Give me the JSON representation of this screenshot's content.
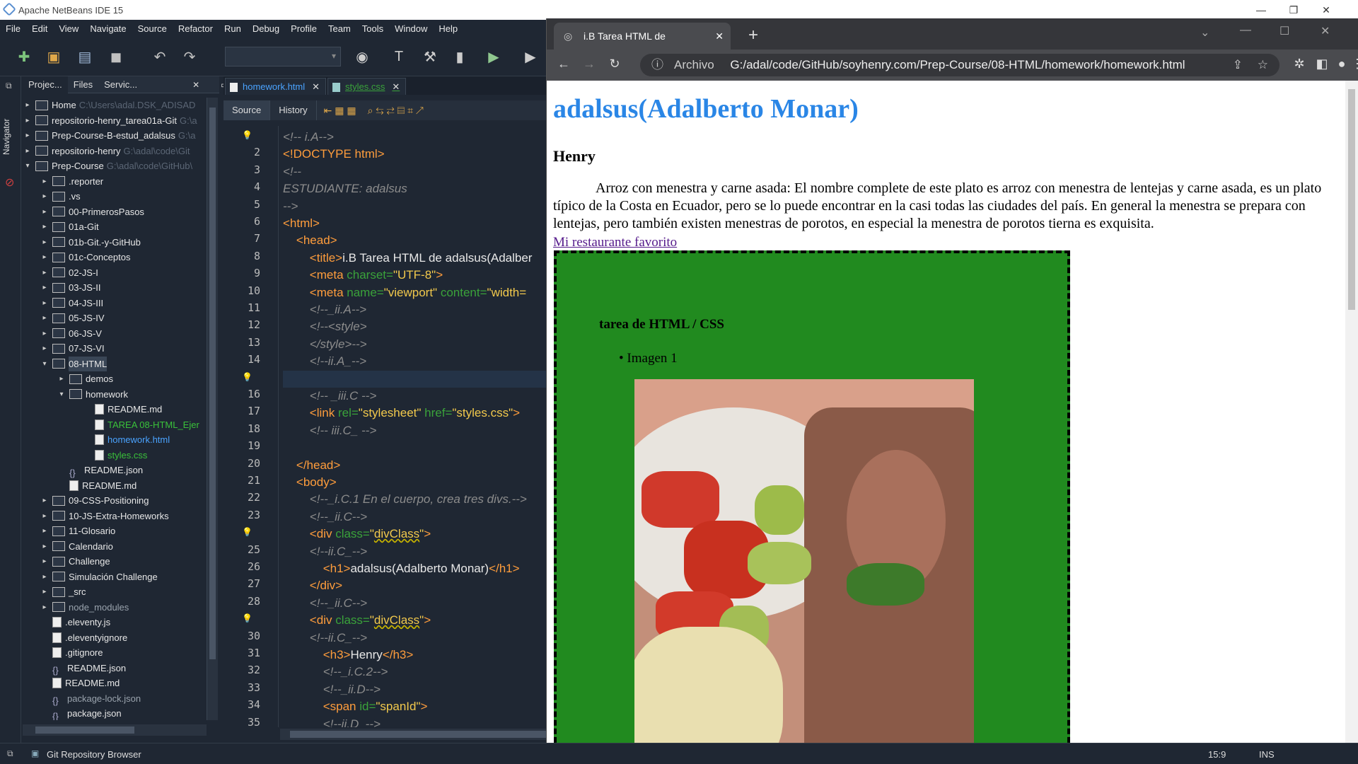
{
  "window": {
    "title": "Apache NetBeans IDE 15"
  },
  "menu": [
    "File",
    "Edit",
    "View",
    "Navigate",
    "Source",
    "Refactor",
    "Run",
    "Debug",
    "Profile",
    "Team",
    "Tools",
    "Window",
    "Help"
  ],
  "navigator_label": "Navigator",
  "project_tabs": [
    "Projec...",
    "Files",
    "Servic..."
  ],
  "tree": [
    {
      "label": "Home",
      "path": "C:\\Users\\adal.DSK_ADISAD",
      "level": 0
    },
    {
      "label": "repositorio-henry_tarea01a-Git",
      "path": "G:\\a",
      "level": 0
    },
    {
      "label": "Prep-Course-B-estud_adalsus",
      "path": "G:\\a",
      "level": 0
    },
    {
      "label": "repositorio-henry",
      "path": "G:\\adal\\code\\Git",
      "level": 0
    },
    {
      "label": "Prep-Course",
      "path": "G:\\adal\\code\\GitHub\\",
      "level": 0
    },
    {
      "label": ".reporter",
      "path": "",
      "level": 1
    },
    {
      "label": ".vs",
      "path": "",
      "level": 1
    },
    {
      "label": "00-PrimerosPasos",
      "path": "",
      "level": 1
    },
    {
      "label": "01a-Git",
      "path": "",
      "level": 1
    },
    {
      "label": "01b-Git.-y-GitHub",
      "path": "",
      "level": 1
    },
    {
      "label": "01c-Conceptos",
      "path": "",
      "level": 1
    },
    {
      "label": "02-JS-I",
      "path": "",
      "level": 1
    },
    {
      "label": "03-JS-II",
      "path": "",
      "level": 1
    },
    {
      "label": "04-JS-III",
      "path": "",
      "level": 1
    },
    {
      "label": "05-JS-IV",
      "path": "",
      "level": 1
    },
    {
      "label": "06-JS-V",
      "path": "",
      "level": 1
    },
    {
      "label": "07-JS-VI",
      "path": "",
      "level": 1
    },
    {
      "label": "08-HTML",
      "path": "",
      "level": 1
    },
    {
      "label": "demos",
      "path": "",
      "level": 2
    },
    {
      "label": "homework",
      "path": "",
      "level": 2
    },
    {
      "label": "README.md",
      "path": "",
      "level": 3
    },
    {
      "label": "TAREA 08-HTML_Ejer",
      "path": "",
      "level": 3
    },
    {
      "label": "homework.html",
      "path": "",
      "level": 3
    },
    {
      "label": "styles.css",
      "path": "",
      "level": 3
    },
    {
      "label": "README.json",
      "path": "",
      "level": 2
    },
    {
      "label": "README.md",
      "path": "",
      "level": 2
    },
    {
      "label": "09-CSS-Positioning",
      "path": "",
      "level": 1
    },
    {
      "label": "10-JS-Extra-Homeworks",
      "path": "",
      "level": 1
    },
    {
      "label": "11-Glosario",
      "path": "",
      "level": 1
    },
    {
      "label": "Calendario",
      "path": "",
      "level": 1
    },
    {
      "label": "Challenge",
      "path": "",
      "level": 1
    },
    {
      "label": "Simulación Challenge",
      "path": "",
      "level": 1
    },
    {
      "label": "_src",
      "path": "",
      "level": 1
    },
    {
      "label": "node_modules",
      "path": "",
      "level": 1
    },
    {
      "label": ".eleventy.js",
      "path": "",
      "level": 1
    },
    {
      "label": ".eleventyignore",
      "path": "",
      "level": 1
    },
    {
      "label": ".gitignore",
      "path": "",
      "level": 1
    },
    {
      "label": "README.json",
      "path": "",
      "level": 1
    },
    {
      "label": "README.md",
      "path": "",
      "level": 1
    },
    {
      "label": "package-lock.json",
      "path": "",
      "level": 1
    },
    {
      "label": "package.json",
      "path": "",
      "level": 1
    }
  ],
  "editor_tabs": [
    "homework.html",
    "styles.css"
  ],
  "editor_modes": [
    "Source",
    "History"
  ],
  "code_lines": [
    {
      "n": "",
      "html": "<span class='cm'>&lt;!-- i.A--&gt;</span>"
    },
    {
      "n": "2",
      "html": "<span class='tg'>&lt;!DOCTYPE html&gt;</span>"
    },
    {
      "n": "3",
      "html": "<span class='cm'>&lt;!--</span>"
    },
    {
      "n": "4",
      "html": "<span class='cm'>ESTUDIANTE:  adalsus</span>"
    },
    {
      "n": "5",
      "html": "<span class='cm'>--&gt;</span>"
    },
    {
      "n": "6",
      "html": "<span class='tg'>&lt;html&gt;</span>"
    },
    {
      "n": "7",
      "html": "&nbsp;&nbsp;&nbsp;&nbsp;<span class='tg'>&lt;head&gt;</span>"
    },
    {
      "n": "8",
      "html": "&nbsp;&nbsp;&nbsp;&nbsp;&nbsp;&nbsp;&nbsp;&nbsp;<span class='tg'>&lt;title&gt;</span>i.B Tarea HTML de adalsus(Adalber"
    },
    {
      "n": "9",
      "html": "&nbsp;&nbsp;&nbsp;&nbsp;&nbsp;&nbsp;&nbsp;&nbsp;<span class='tg'>&lt;meta</span> <span class='at'>charset=</span><span class='st'>\"UTF-8\"</span><span class='tg'>&gt;</span>"
    },
    {
      "n": "10",
      "html": "&nbsp;&nbsp;&nbsp;&nbsp;&nbsp;&nbsp;&nbsp;&nbsp;<span class='tg'>&lt;meta</span> <span class='at'>name=</span><span class='st'>\"viewport\"</span> <span class='at'>content=</span><span class='st'>\"width=</span>"
    },
    {
      "n": "11",
      "html": "&nbsp;&nbsp;&nbsp;&nbsp;&nbsp;&nbsp;&nbsp;&nbsp;<span class='cm'>&lt;!--_ii.A--&gt;</span>"
    },
    {
      "n": "12",
      "html": "&nbsp;&nbsp;&nbsp;&nbsp;&nbsp;&nbsp;&nbsp;&nbsp;<span class='cm'>&lt;!--&lt;style&gt;</span>"
    },
    {
      "n": "13",
      "html": "&nbsp;&nbsp;&nbsp;&nbsp;&nbsp;&nbsp;&nbsp;&nbsp;<span class='cm'>&lt;/style&gt;--&gt;</span>"
    },
    {
      "n": "14",
      "html": "&nbsp;&nbsp;&nbsp;&nbsp;&nbsp;&nbsp;&nbsp;&nbsp;<span class='cm'>&lt;!--ii.A_--&gt;</span>"
    },
    {
      "n": "",
      "html": ""
    },
    {
      "n": "16",
      "html": "&nbsp;&nbsp;&nbsp;&nbsp;&nbsp;&nbsp;&nbsp;&nbsp;<span class='cm'>&lt;!-- _iii.C --&gt;</span>"
    },
    {
      "n": "17",
      "html": "&nbsp;&nbsp;&nbsp;&nbsp;&nbsp;&nbsp;&nbsp;&nbsp;<span class='tg'>&lt;link</span> <span class='at'>rel=</span><span class='st'>\"stylesheet\"</span> <span class='at'>href=</span><span class='st'>\"styles.css\"</span><span class='tg'>&gt;</span>"
    },
    {
      "n": "18",
      "html": "&nbsp;&nbsp;&nbsp;&nbsp;&nbsp;&nbsp;&nbsp;&nbsp;<span class='cm'>&lt;!-- iii.C_ --&gt;</span>"
    },
    {
      "n": "19",
      "html": ""
    },
    {
      "n": "20",
      "html": "&nbsp;&nbsp;&nbsp;&nbsp;<span class='tg'>&lt;/head&gt;</span>"
    },
    {
      "n": "21",
      "html": "&nbsp;&nbsp;&nbsp;&nbsp;<span class='tg'>&lt;body&gt;</span>"
    },
    {
      "n": "22",
      "html": "&nbsp;&nbsp;&nbsp;&nbsp;&nbsp;&nbsp;&nbsp;&nbsp;<span class='cm'>&lt;!--_i.C.1 En el cuerpo, crea tres divs.--&gt;</span>"
    },
    {
      "n": "23",
      "html": "&nbsp;&nbsp;&nbsp;&nbsp;&nbsp;&nbsp;&nbsp;&nbsp;<span class='cm'>&lt;!--_ii.C--&gt;</span>"
    },
    {
      "n": "",
      "html": "&nbsp;&nbsp;&nbsp;&nbsp;&nbsp;&nbsp;&nbsp;&nbsp;<span class='tg'>&lt;div</span> <span class='at'>class=</span><span class='st'>\"<span class='uw'>divClass</span>\"</span><span class='tg'>&gt;</span>"
    },
    {
      "n": "25",
      "html": "&nbsp;&nbsp;&nbsp;&nbsp;&nbsp;&nbsp;&nbsp;&nbsp;<span class='cm'>&lt;!--ii.C_--&gt;</span>"
    },
    {
      "n": "26",
      "html": "&nbsp;&nbsp;&nbsp;&nbsp;&nbsp;&nbsp;&nbsp;&nbsp;&nbsp;&nbsp;&nbsp;&nbsp;<span class='tg'>&lt;h1&gt;</span>adalsus(Adalberto Monar)<span class='tg'>&lt;/h1&gt;</span>"
    },
    {
      "n": "27",
      "html": "&nbsp;&nbsp;&nbsp;&nbsp;&nbsp;&nbsp;&nbsp;&nbsp;<span class='tg'>&lt;/div&gt;</span>"
    },
    {
      "n": "28",
      "html": "&nbsp;&nbsp;&nbsp;&nbsp;&nbsp;&nbsp;&nbsp;&nbsp;<span class='cm'>&lt;!--_ii.C--&gt;</span>"
    },
    {
      "n": "",
      "html": "&nbsp;&nbsp;&nbsp;&nbsp;&nbsp;&nbsp;&nbsp;&nbsp;<span class='tg'>&lt;div</span> <span class='at'>class=</span><span class='st'>\"<span class='uw'>divClass</span>\"</span><span class='tg'>&gt;</span>"
    },
    {
      "n": "30",
      "html": "&nbsp;&nbsp;&nbsp;&nbsp;&nbsp;&nbsp;&nbsp;&nbsp;<span class='cm'>&lt;!--ii.C_--&gt;</span>"
    },
    {
      "n": "31",
      "html": "&nbsp;&nbsp;&nbsp;&nbsp;&nbsp;&nbsp;&nbsp;&nbsp;&nbsp;&nbsp;&nbsp;&nbsp;<span class='tg'>&lt;h3&gt;</span>Henry<span class='tg'>&lt;/h3&gt;</span>"
    },
    {
      "n": "32",
      "html": "&nbsp;&nbsp;&nbsp;&nbsp;&nbsp;&nbsp;&nbsp;&nbsp;&nbsp;&nbsp;&nbsp;&nbsp;<span class='cm'>&lt;!--_i.C.2--&gt;</span>"
    },
    {
      "n": "33",
      "html": "&nbsp;&nbsp;&nbsp;&nbsp;&nbsp;&nbsp;&nbsp;&nbsp;&nbsp;&nbsp;&nbsp;&nbsp;<span class='cm'>&lt;!--_ii.D--&gt;</span>"
    },
    {
      "n": "34",
      "html": "&nbsp;&nbsp;&nbsp;&nbsp;&nbsp;&nbsp;&nbsp;&nbsp;&nbsp;&nbsp;&nbsp;&nbsp;<span class='tg'>&lt;span</span> <span class='at'>id=</span><span class='st'>\"spanId\"</span><span class='tg'>&gt;</span>"
    },
    {
      "n": "35",
      "html": "&nbsp;&nbsp;&nbsp;&nbsp;&nbsp;&nbsp;&nbsp;&nbsp;&nbsp;&nbsp;&nbsp;&nbsp;<span class='cm'>&lt;!--ii.D_--&gt;</span>"
    }
  ],
  "browser": {
    "tab_title": "i.B Tarea HTML de adalsus(Adalb",
    "security_label": "Archivo",
    "url": "G:/adal/code/GitHub/soyhenry.com/Prep-Course/08-HTML/homework/homework.html"
  },
  "page": {
    "h1": "adalsus(Adalberto Monar)",
    "h3": "Henry",
    "paragraph": "Arroz con menestra y carne asada: El nombre complete de este plato es arroz con menestra de lentejas y carne asada, es un plato típico de la Costa en Ecuador, pero se lo puede encontrar en la casi todas las ciudades del país. En general la menestra se prepara con lentejas, pero también existen menestras de porotos, en especial la menestra de porotos tierna es exquisita.",
    "link": "Mi restaurante favorito",
    "box_title": "tarea de HTML / CSS",
    "list_item": "Imagen 1"
  },
  "status": {
    "git": "Git Repository Browser",
    "position": "15:9",
    "mode": "INS"
  }
}
